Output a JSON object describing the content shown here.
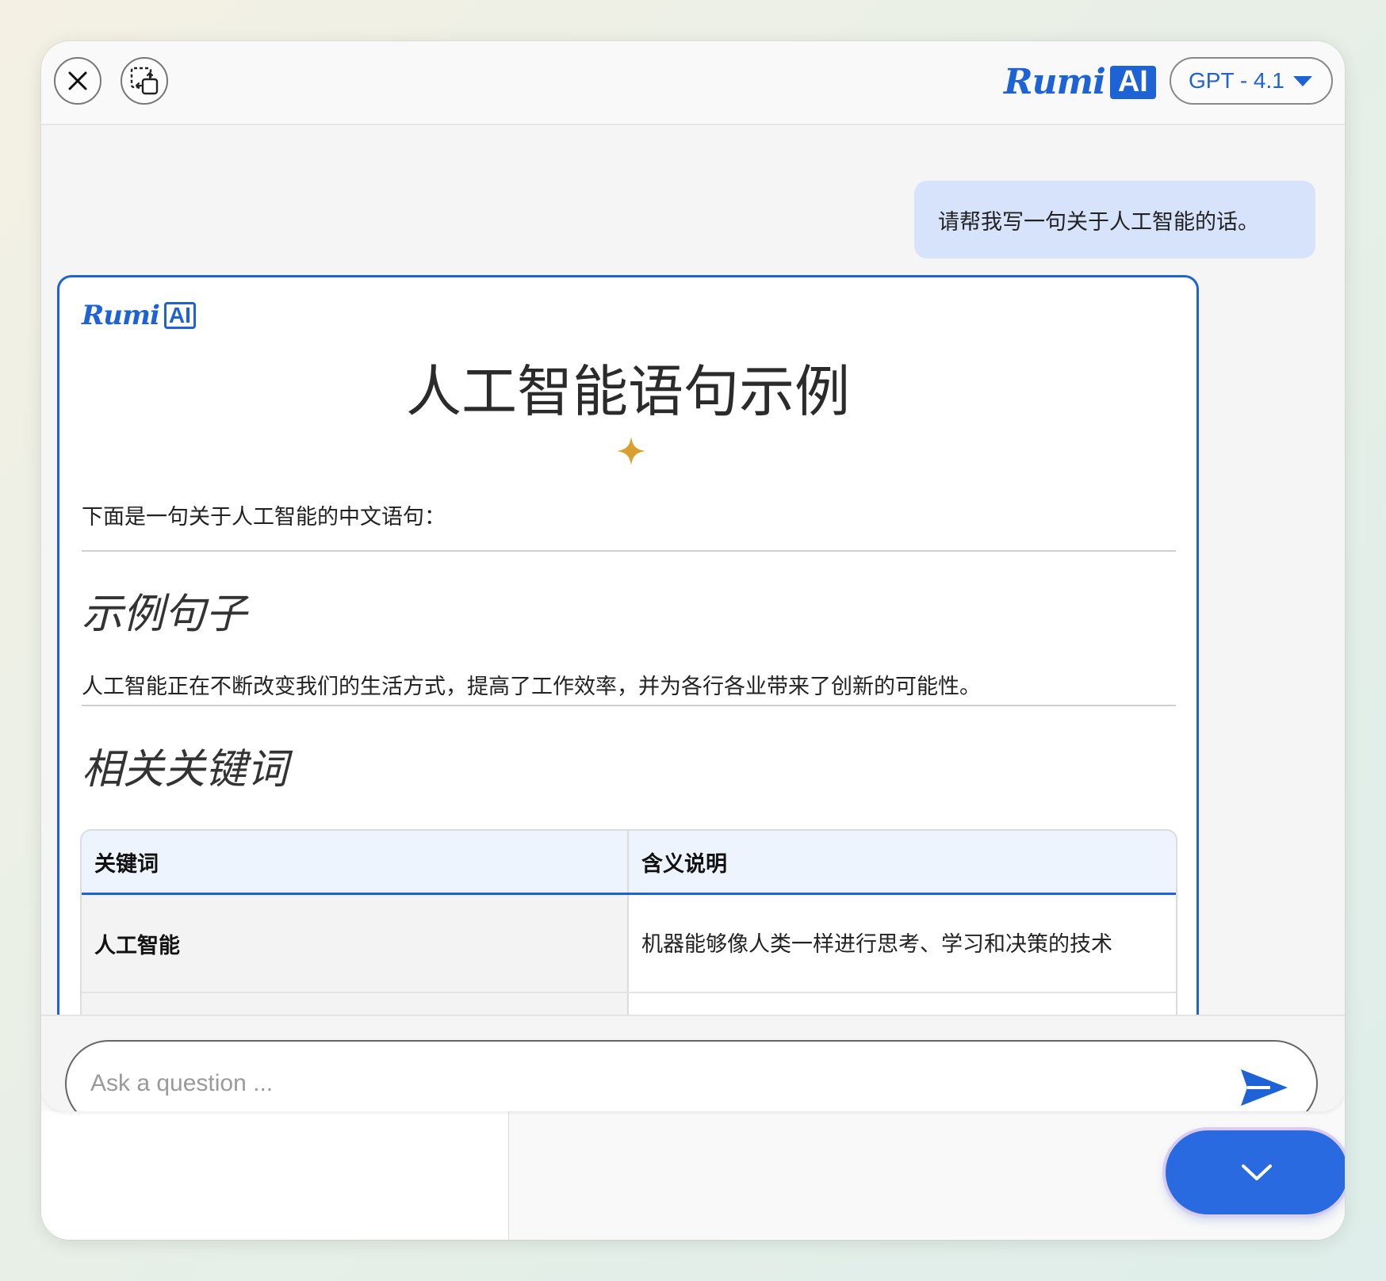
{
  "header": {
    "logo_word": "Rumi",
    "logo_badge": "AI",
    "model_label": "GPT - 4.1"
  },
  "chat": {
    "user_message": "请帮我写一句关于人工智能的话。",
    "answer": {
      "logo_word": "Rumi",
      "logo_badge": "AI",
      "title": "人工智能语句示例",
      "intro": "下面是一句关于人工智能的中文语句：",
      "section1_heading": "示例句子",
      "sentence": "人工智能正在不断改变我们的生活方式，提高了工作效率，并为各行各业带来了创新的可能性。",
      "section2_heading": "相关关键词",
      "table": {
        "headers": [
          "关键词",
          "含义说明"
        ],
        "rows": [
          [
            "人工智能",
            "机器能够像人类一样进行思考、学习和决策的技术"
          ]
        ]
      }
    }
  },
  "composer": {
    "placeholder": "Ask a question ..."
  },
  "icons": {
    "close": "close-icon",
    "capture": "screen-capture-icon",
    "caret": "caret-down-icon",
    "sparkle": "sparkle-icon",
    "send": "send-icon",
    "scroll_down": "chevron-down-icon"
  },
  "colors": {
    "brand": "#1e63d6",
    "user_bubble": "#d6e3fb",
    "sparkle": "#d9a030"
  }
}
